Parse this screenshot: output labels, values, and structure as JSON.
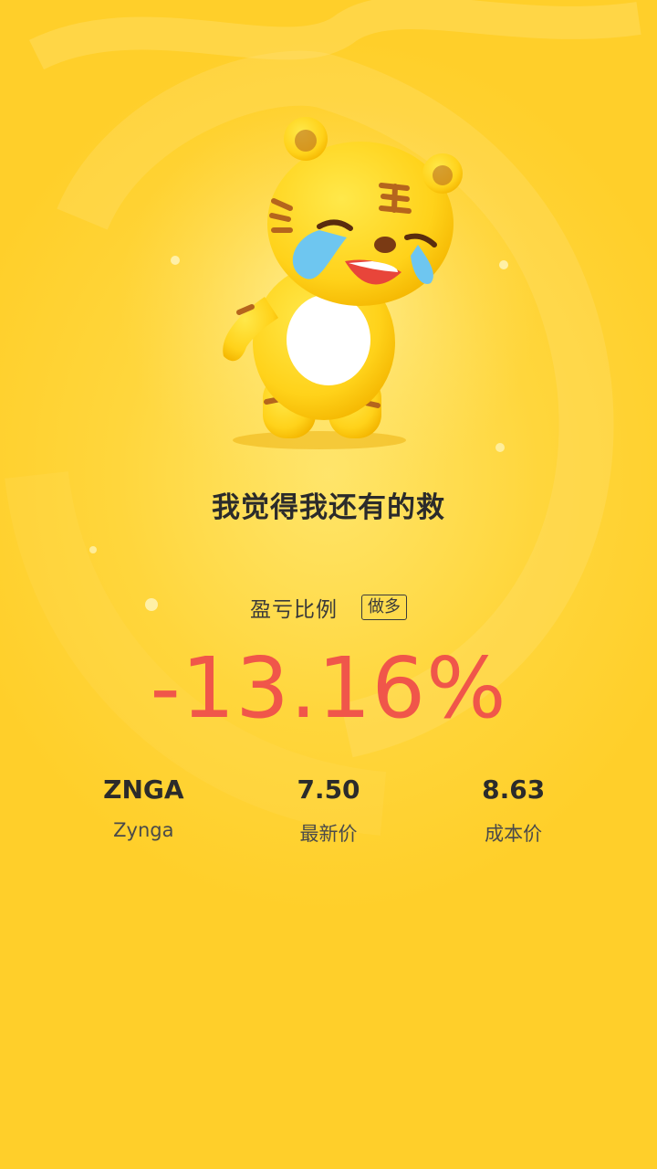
{
  "colors": {
    "background": "#ffd63c",
    "negative": "#f0564a",
    "text": "#2b2b2b"
  },
  "mascot": {
    "name": "crying-tiger-mascot",
    "eyebrow_mark": "王"
  },
  "headline": "我觉得我还有的救",
  "profit_loss": {
    "label": "盈亏比例",
    "tag": "做多",
    "value": "-13.16%"
  },
  "stats": [
    {
      "value": "ZNGA",
      "label": "Zynga"
    },
    {
      "value": "7.50",
      "label": "最新价"
    },
    {
      "value": "8.63",
      "label": "成本价"
    }
  ]
}
